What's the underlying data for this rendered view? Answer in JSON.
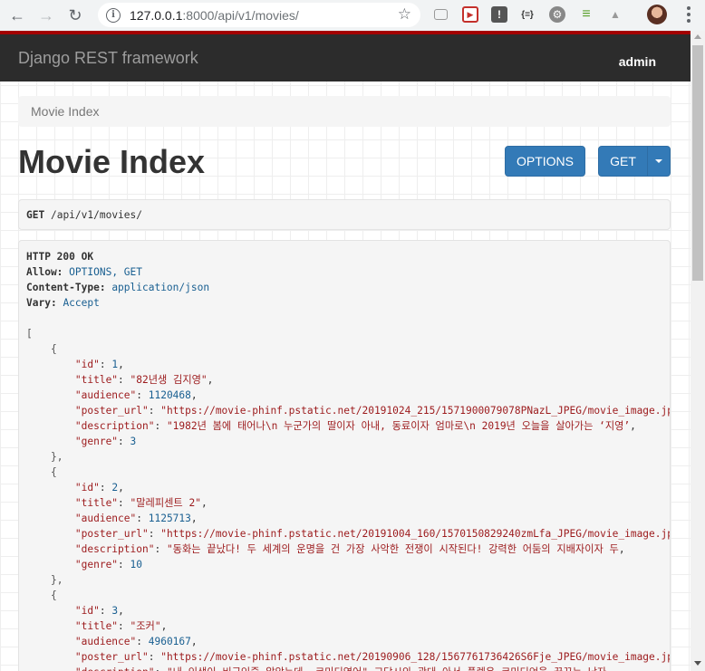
{
  "browser": {
    "url_host": "127.0.0.1",
    "url_rest": ":8000/api/v1/movies/",
    "icons": [
      "back-icon",
      "forward-icon",
      "reload-icon",
      "site-info-icon",
      "bookmark-star-icon",
      "extension-icons",
      "profile-avatar",
      "menu-icon"
    ]
  },
  "navbar": {
    "brand": "Django REST framework",
    "user": "admin"
  },
  "breadcrumb": "Movie Index",
  "page_title": "Movie Index",
  "buttons": {
    "options": "OPTIONS",
    "get": "GET"
  },
  "request": {
    "method": "GET",
    "path": "/api/v1/movies/"
  },
  "response": {
    "status": "HTTP 200 OK",
    "headers": [
      {
        "name": "Allow:",
        "value": "OPTIONS, GET"
      },
      {
        "name": "Content-Type:",
        "value": "application/json"
      },
      {
        "name": "Vary:",
        "value": "Accept"
      }
    ],
    "movies": [
      {
        "id": "1",
        "title": "\"82년생 김지영\"",
        "audience": "1120468",
        "poster_url": "\"https://movie-phinf.pstatic.net/20191024_215/1571900079078PNazL_JPEG/movie_image.jpg\"",
        "description": "\"1982년 봄에 태어나\\n 누군가의 딸이자 아내, 동료이자 엄마로\\n 2019년 오늘을 살아가는 ‘지영’",
        "genre": "3"
      },
      {
        "id": "2",
        "title": "\"말레피센트 2\"",
        "audience": "1125713",
        "poster_url": "\"https://movie-phinf.pstatic.net/20191004_160/1570150829240zmLfa_JPEG/movie_image.jpg\"",
        "description": "\"동화는 끝났다! 두 세계의 운명을 건 가장 사악한 전쟁이 시작된다! 강력한 어둠의 지배자이자 두",
        "genre": "10"
      },
      {
        "id": "3",
        "title": "\"조커\"",
        "audience": "4960167",
        "poster_url": "\"https://movie-phinf.pstatic.net/20190906_128/1567761736426S6Fje_JPEG/movie_image.jpg\"",
        "description": "\"내 인생이 비극인줄 알았는데, 코미디였어\" 고담시의 광대 아서 플렉은 코미디언을 꿈꾸는 남자",
        "genre": ""
      }
    ]
  }
}
